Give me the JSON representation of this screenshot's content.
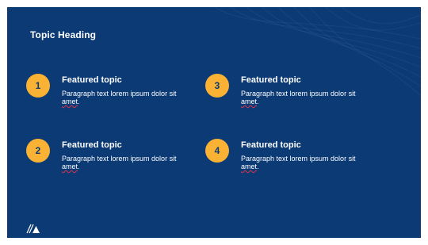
{
  "slide": {
    "heading": "Topic Heading",
    "accent_color": "#f9b233",
    "background_color": "#0b3a75",
    "logo_icon": "logo-mark-icon",
    "topics": [
      {
        "number": "1",
        "title": "Featured topic",
        "body_prefix": "Paragraph text lorem ipsum dolor sit",
        "body_flagged": "amet",
        "body_suffix": "."
      },
      {
        "number": "2",
        "title": "Featured topic",
        "body_prefix": "Paragraph text lorem ipsum dolor sit",
        "body_flagged": "amet",
        "body_suffix": "."
      },
      {
        "number": "3",
        "title": "Featured topic",
        "body_prefix": "Paragraph text lorem ipsum dolor sit",
        "body_flagged": "amet",
        "body_suffix": "."
      },
      {
        "number": "4",
        "title": "Featured topic",
        "body_prefix": "Paragraph text lorem ipsum dolor sit",
        "body_flagged": "amet",
        "body_suffix": "."
      }
    ]
  }
}
